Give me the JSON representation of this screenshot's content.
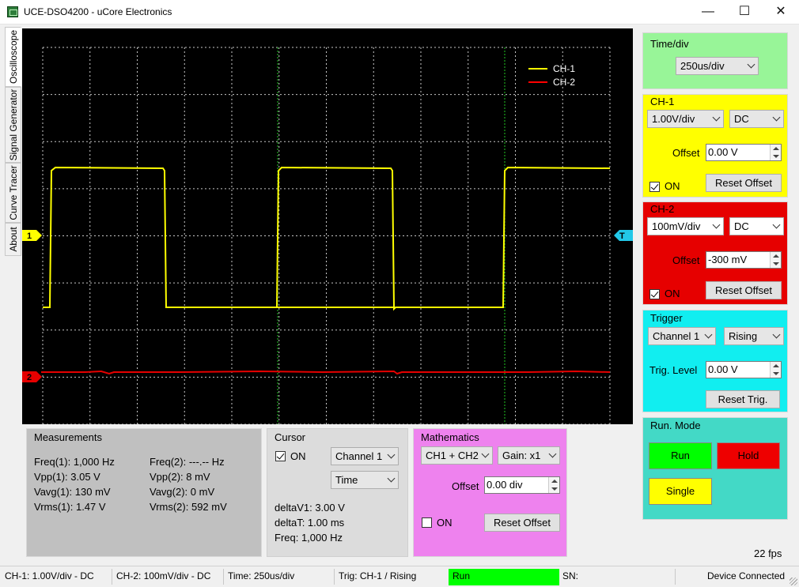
{
  "window": {
    "title": "UCE-DSO4200 - uCore Electronics",
    "minimize": "—",
    "maximize": "☐",
    "close": "✕"
  },
  "tabs": [
    "Oscilloscope",
    "Signal Generator",
    "Curve Tracer",
    "About"
  ],
  "scope": {
    "legend": [
      {
        "name": "CH-1",
        "color": "#ffff00"
      },
      {
        "name": "CH-2",
        "color": "#ff0000"
      }
    ],
    "markers": {
      "ch1": "1",
      "ch2": "2",
      "trigger": "T"
    },
    "colors": {
      "ch1": "#ffff00",
      "ch2": "#e60000",
      "trigger": "#22c8e8",
      "grid": "#c8c8c8",
      "cursor": "#22c822"
    }
  },
  "timediv": {
    "title": "Time/div",
    "value": "250us/div",
    "color": "#98f598"
  },
  "ch1": {
    "title": "CH-1",
    "volts": "1.00V/div",
    "coupling": "DC",
    "offset_label": "Offset",
    "offset": "0.00 V",
    "reset": "Reset Offset",
    "on_label": "ON",
    "on": true,
    "color": "#ffff00"
  },
  "ch2": {
    "title": "CH-2",
    "volts": "100mV/div",
    "coupling": "DC",
    "offset_label": "Offset",
    "offset": "-300 mV",
    "reset": "Reset Offset",
    "on_label": "ON",
    "on": true,
    "color": "#e60000"
  },
  "trigger": {
    "title": "Trigger",
    "source": "Channel 1",
    "edge": "Rising",
    "level_label": "Trig. Level",
    "level": "0.00 V",
    "reset": "Reset Trig.",
    "color": "#11eef0"
  },
  "runmode": {
    "title": "Run. Mode",
    "run": "Run",
    "hold": "Hold",
    "single": "Single",
    "color": "#43d9c6"
  },
  "measurements": {
    "title": "Measurements",
    "left": [
      "Freq(1): 1,000 Hz",
      "Vpp(1): 3.05 V",
      "Vavg(1): 130 mV",
      "Vrms(1): 1.47 V"
    ],
    "right": [
      "Freq(2): ---.-- Hz",
      "Vpp(2): 8 mV",
      "Vavg(2): 0 mV",
      "Vrms(2): 592 mV"
    ]
  },
  "cursor": {
    "title": "Cursor",
    "on_label": "ON",
    "channel": "Channel 1",
    "mode": "Time",
    "lines": [
      "deltaV1: 3.00 V",
      "deltaT: 1.00 ms",
      "Freq: 1,000 Hz"
    ]
  },
  "math": {
    "title": "Mathematics",
    "op": "CH1 + CH2",
    "gain": "Gain: x1",
    "offset_label": "Offset",
    "offset": "0.00 div",
    "on_label": "ON",
    "reset": "Reset Offset",
    "color": "#ee82ee"
  },
  "fps": "22 fps",
  "status": {
    "ch1": "CH-1: 1.00V/div - DC",
    "ch2": "CH-2: 100mV/div - DC",
    "time": "Time: 250us/div",
    "trig": "Trig: CH-1 / Rising",
    "run": "Run",
    "sn": "SN:",
    "conn": "Device Connected"
  }
}
